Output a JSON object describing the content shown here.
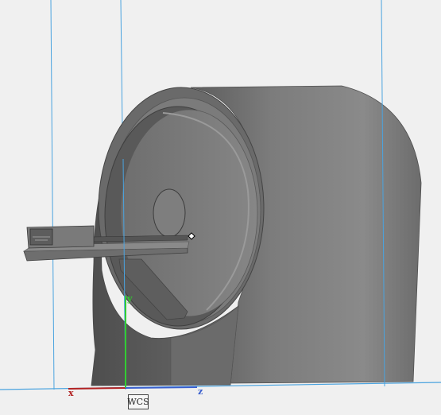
{
  "axes": {
    "x_label": "x",
    "y_label": "y",
    "z_label": "z",
    "x_color": "#b22222",
    "y_color": "#32cd32",
    "z_color": "#3a5fcd"
  },
  "wcs_label": "WCS",
  "colors": {
    "background": "#f0f0f0",
    "guide_line": "#4aa3df",
    "body_dark": "#595959",
    "body_mid": "#7a7a7a",
    "body_light": "#8e8e8e"
  }
}
